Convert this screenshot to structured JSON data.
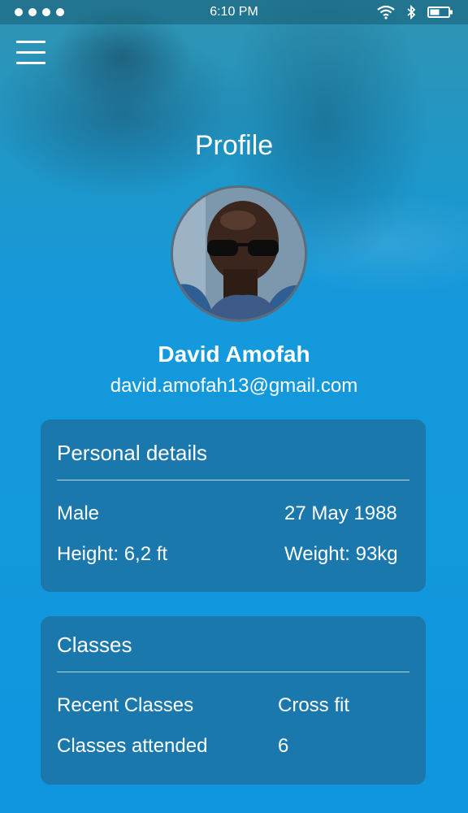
{
  "status_bar": {
    "time": "6:10 PM",
    "icons": [
      "signal-dots",
      "wifi-icon",
      "bluetooth-icon",
      "battery-icon"
    ]
  },
  "header": {
    "title": "Profile"
  },
  "profile": {
    "name": "David Amofah",
    "email": "david.amofah13@gmail.com"
  },
  "personal_details": {
    "title": "Personal details",
    "gender": "Male",
    "birth_date": "27 May 1988",
    "height": "Height: 6,2 ft",
    "weight": "Weight: 93kg"
  },
  "classes": {
    "title": "Classes",
    "recent_label": "Recent Classes",
    "recent_value": "Cross fit",
    "attended_label": "Classes attended",
    "attended_value": "6"
  },
  "colors": {
    "background": "#1599dc",
    "card": "#1a78ad",
    "text": "#ffffff"
  }
}
